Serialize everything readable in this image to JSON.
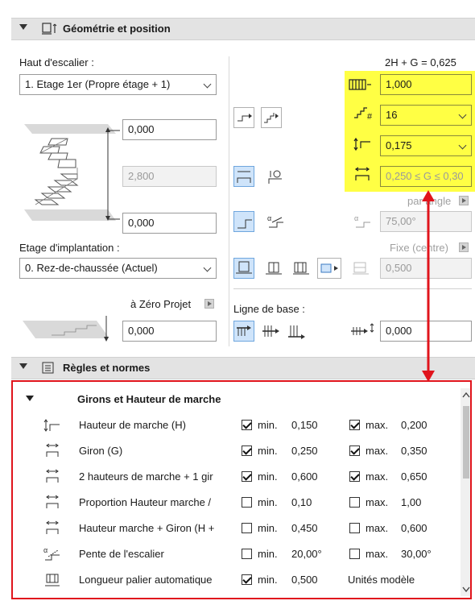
{
  "section1": {
    "title": "Géométrie et position",
    "icon": "stair-geometry-icon"
  },
  "left": {
    "top_level_label": "Haut d'escalier :",
    "top_level_value": "1. Etage 1er (Propre étage + 1)",
    "height_top": "0,000",
    "height_total": "2,800",
    "height_bottom": "0,000",
    "home_level_label": "Etage d'implantation :",
    "home_level_value": "0. Rez-de-chaussée (Actuel)",
    "ref_label": "à Zéro Projet",
    "ref_value": "0,000"
  },
  "right": {
    "formula": "2H + G = 0,625",
    "flight_length": "1,000",
    "risers": "16",
    "riser_height": "0,175",
    "tread_range": "0,250 ≤ G ≤ 0,30",
    "by_angle": "par angle",
    "angle": "75,00°",
    "fixed_center": "Fixe (centre)",
    "width": "0,500",
    "baseline_label": "Ligne de base :",
    "baseline_value": "0,000"
  },
  "section2": {
    "title": "Règles et normes",
    "icon": "rules-icon"
  },
  "rules": {
    "group_title": "Girons et Hauteur de marche",
    "rows": [
      {
        "name": "Hauteur de marche (H)",
        "min_checked": true,
        "min_label": "min.",
        "min": "0,150",
        "max_checked": true,
        "max_label": "max.",
        "max": "0,200"
      },
      {
        "name": "Giron (G)",
        "min_checked": true,
        "min_label": "min.",
        "min": "0,250",
        "max_checked": true,
        "max_label": "max.",
        "max": "0,350"
      },
      {
        "name": "2 hauteurs de marche + 1 gir",
        "min_checked": true,
        "min_label": "min.",
        "min": "0,600",
        "max_checked": true,
        "max_label": "max.",
        "max": "0,650"
      },
      {
        "name": "Proportion Hauteur marche /",
        "min_checked": false,
        "min_label": "min.",
        "min": "0,10",
        "max_checked": false,
        "max_label": "max.",
        "max": "1,00"
      },
      {
        "name": "Hauteur marche + Giron (H +",
        "min_checked": false,
        "min_label": "min.",
        "min": "0,450",
        "max_checked": false,
        "max_label": "max.",
        "max": "0,600"
      },
      {
        "name": "Pente de l'escalier",
        "min_checked": false,
        "min_label": "min.",
        "min": "20,00°",
        "max_checked": false,
        "max_label": "max.",
        "max": "30,00°"
      },
      {
        "name": "Longueur palier automatique",
        "min_checked": true,
        "min_label": "min.",
        "min": "0,500",
        "units": "Unités modèle"
      }
    ]
  },
  "colors": {
    "highlight": "#ffff44",
    "annotation": "#e0141c",
    "selected": "#cfe4fa"
  }
}
